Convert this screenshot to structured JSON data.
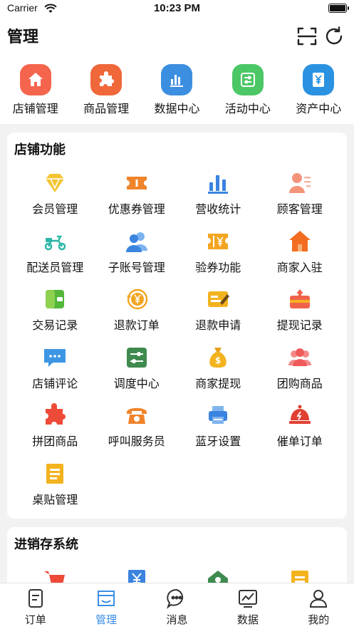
{
  "status_bar": {
    "carrier": "Carrier",
    "time": "10:23 PM"
  },
  "header": {
    "title": "管理"
  },
  "quick_actions": [
    {
      "label": "店铺管理",
      "icon": "store-icon",
      "color": "#f5654d"
    },
    {
      "label": "商品管理",
      "icon": "puzzle-icon",
      "color": "#f0673a"
    },
    {
      "label": "数据中心",
      "icon": "bar-chart-icon",
      "color": "#3c8fe0"
    },
    {
      "label": "活动中心",
      "icon": "toggle-icon",
      "color": "#4cc766"
    },
    {
      "label": "资产中心",
      "icon": "yuan-icon",
      "color": "#2b92e2"
    }
  ],
  "store_functions": {
    "title": "店铺功能",
    "items": [
      {
        "label": "会员管理",
        "icon": "diamond-icon"
      },
      {
        "label": "优惠券管理",
        "icon": "coupon-icon"
      },
      {
        "label": "营收统计",
        "icon": "bar-chart-icon"
      },
      {
        "label": "顾客管理",
        "icon": "customer-icon"
      },
      {
        "label": "配送员管理",
        "icon": "scooter-icon"
      },
      {
        "label": "子账号管理",
        "icon": "users-icon"
      },
      {
        "label": "验券功能",
        "icon": "ticket-icon"
      },
      {
        "label": "商家入驻",
        "icon": "house-icon"
      },
      {
        "label": "交易记录",
        "icon": "wallet-icon"
      },
      {
        "label": "退款订单",
        "icon": "refund-icon"
      },
      {
        "label": "退款申请",
        "icon": "card-icon"
      },
      {
        "label": "提现记录",
        "icon": "withdraw-icon"
      },
      {
        "label": "店铺评论",
        "icon": "comment-icon"
      },
      {
        "label": "调度中心",
        "icon": "sliders-icon"
      },
      {
        "label": "商家提现",
        "icon": "money-bag-icon"
      },
      {
        "label": "团购商品",
        "icon": "group-icon"
      },
      {
        "label": "拼团商品",
        "icon": "puzzle-icon"
      },
      {
        "label": "呼叫服务员",
        "icon": "phone-icon"
      },
      {
        "label": "蓝牙设置",
        "icon": "printer-icon"
      },
      {
        "label": "催单订单",
        "icon": "bell-icon"
      },
      {
        "label": "桌贴管理",
        "icon": "note-icon"
      }
    ]
  },
  "inventory_system": {
    "title": "进销存系统",
    "icons": [
      "cart-icon",
      "yuan-doc-icon",
      "warehouse-icon",
      "list-icon"
    ]
  },
  "tab_bar": {
    "active": "管理",
    "tabs": [
      {
        "label": "订单",
        "icon": "order-icon"
      },
      {
        "label": "管理",
        "icon": "manage-icon"
      },
      {
        "label": "消息",
        "icon": "message-icon"
      },
      {
        "label": "数据",
        "icon": "data-icon"
      },
      {
        "label": "我的",
        "icon": "profile-icon"
      }
    ]
  }
}
